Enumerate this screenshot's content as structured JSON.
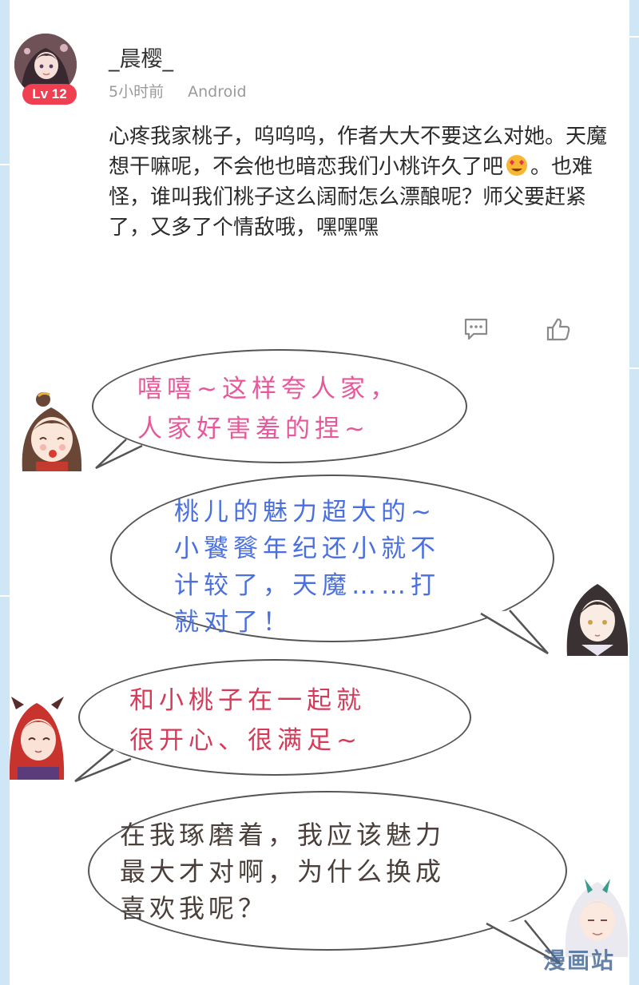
{
  "comment": {
    "username": "_晨樱_",
    "level_badge": "Lv 12",
    "time": "5小时前",
    "device": "Android",
    "text_before_emoji": "心疼我家桃子，呜呜呜，作者大大不要这么对她。天魔想干嘛呢，不会他也暗恋我们小桃许久了吧",
    "emoji": "heart-eyes-emoji",
    "text_after_emoji": "。也难怪，谁叫我们桃子这么阔耐怎么漂酿呢？师父要赶紧了，又多了个情敌哦，嘿嘿嘿",
    "actions": {
      "reply_icon": "comment-icon",
      "like_icon": "thumbs-up-icon"
    }
  },
  "bubbles": [
    {
      "text_line1": "嘻嘻~这样夸人家，",
      "text_line2": "人家好害羞的捏~",
      "color": "#e8579a",
      "character": "girl-with-brown-hair"
    },
    {
      "text_line1": "桃儿的魅力超大的~",
      "text_line2": "小饕餮年纪还小就不",
      "text_line3": "计较了，天魔……打",
      "text_line4": "就对了！",
      "color": "#4a6fe0",
      "character": "dark-haired-man"
    },
    {
      "text_line1": "和小桃子在一起就",
      "text_line2": "很开心、很满足~",
      "color": "#d63a59",
      "character": "red-haired-girl"
    },
    {
      "text_line1": "在我琢磨着，我应该魅力",
      "text_line2": "最大才对啊，为什么换成",
      "text_line3": "喜欢我呢？",
      "color": "#4a3f3a",
      "character": "white-haired-demon"
    }
  ],
  "watermark": "漫画站"
}
